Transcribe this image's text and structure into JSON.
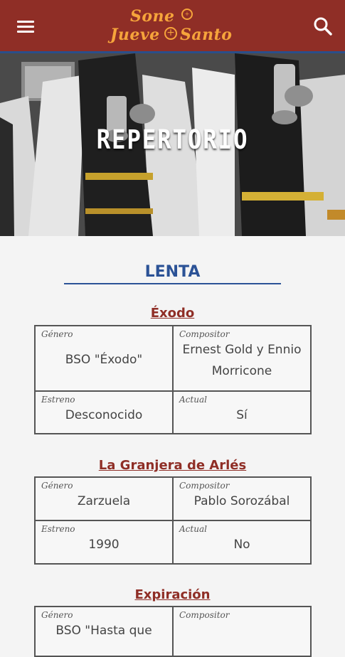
{
  "header": {
    "logo_line1": "Sones",
    "logo_line2": "Jueves Santo",
    "logo_display_1": "Sone",
    "logo_display_2a": "Jueve",
    "logo_display_2b": "anto",
    "brand_color": "#8f2e26",
    "accent_color": "#f6a43b",
    "menu_icon": "hamburger-menu-icon",
    "search_icon": "search-icon"
  },
  "hero": {
    "title": "REPERTORIO"
  },
  "section": {
    "title": "LENTA"
  },
  "pieces": [
    {
      "title": "Éxodo",
      "genero_label": "Género",
      "genero": "BSO \"Éxodo\"",
      "compositor_label": "Compositor",
      "compositor": "Ernest Gold y Ennio Morricone",
      "estreno_label": "Estreno",
      "estreno": "Desconocido",
      "actual_label": "Actual",
      "actual": "Sí"
    },
    {
      "title": "La Granjera de Arlés",
      "genero_label": "Género",
      "genero": "Zarzuela",
      "compositor_label": "Compositor",
      "compositor": "Pablo Sorozábal",
      "estreno_label": "Estreno",
      "estreno": "1990",
      "actual_label": "Actual",
      "actual": "No"
    },
    {
      "title": "Expiración",
      "genero_label": "Género",
      "genero": "BSO \"Hasta que",
      "compositor_label": "Compositor",
      "compositor": ""
    }
  ]
}
